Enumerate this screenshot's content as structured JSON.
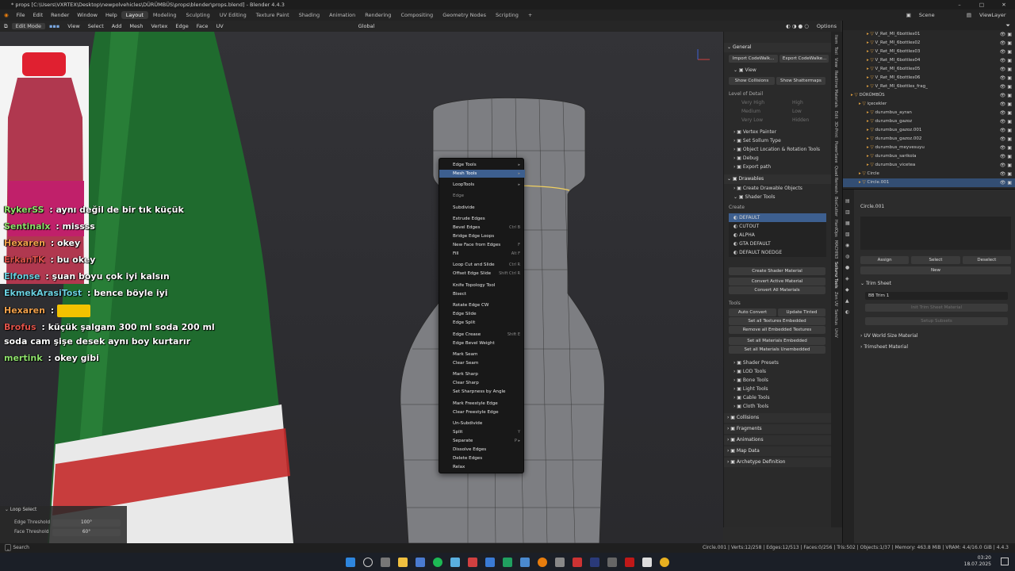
{
  "app": {
    "title": "* props [C:\\Users\\VXRTEX\\Desktop\\newpolvehicles\\DÜRÜMBÜS\\props\\blender\\props.blend] - Blender 4.4.3"
  },
  "menubar": {
    "menus": [
      "File",
      "Edit",
      "Render",
      "Window",
      "Help"
    ],
    "workspaces": [
      "Layout",
      "Modeling",
      "Sculpting",
      "UV Editing",
      "Texture Paint",
      "Shading",
      "Animation",
      "Rendering",
      "Compositing",
      "Geometry Nodes",
      "Scripting"
    ],
    "active_workspace": "Layout",
    "scene_label": "Scene",
    "viewlayer_label": "ViewLayer"
  },
  "viewport_header": {
    "mode": "Edit Mode",
    "items": [
      "View",
      "Select",
      "Add",
      "Mesh",
      "Vertex",
      "Edge",
      "Face",
      "UV"
    ],
    "transform_orientation": "Global",
    "options_label": "Options"
  },
  "chat": [
    {
      "user": "RykerSS",
      "sep": " : ",
      "text": "aynı değil de bir tık küçük",
      "color": "#8ee06b"
    },
    {
      "user": "Sentinalx",
      "sep": " : ",
      "text": "missss",
      "color": "#8ee06b"
    },
    {
      "user": "Hexaren",
      "sep": " : ",
      "text": "okey",
      "color": "#f0a04b"
    },
    {
      "user": "ErkanTK",
      "sep": " : ",
      "text": "bu okey",
      "color": "#e0534a"
    },
    {
      "user": "Elfonse",
      "sep": " : ",
      "text": "şuan boyu çok iyi kalsın",
      "color": "#6ad0e0"
    },
    {
      "user": "EkmekArasiTost",
      "sep": " : ",
      "text": "bence böyle iyi",
      "color": "#6ad0e0"
    },
    {
      "user": "Hexaren",
      "sep": " : ",
      "text": "",
      "color": "#f0a04b"
    },
    {
      "user": "Brofus",
      "sep": " : ",
      "text": "küçük şalgam 300 ml soda 200 ml",
      "color": "#e0534a"
    },
    {
      "user": "",
      "sep": "",
      "text": "soda cam şişe desek aynı boy kurtarır",
      "color": "#ffffff"
    },
    {
      "user": "mertink",
      "sep": " : ",
      "text": "okey gibi",
      "color": "#8ee06b"
    }
  ],
  "context_menu": {
    "items": [
      {
        "label": "Edge Tools",
        "shortcut": "▸",
        "type": "sub"
      },
      {
        "label": "Mesh Tools",
        "shortcut": "▸",
        "type": "sub",
        "highlight": true
      },
      {
        "label": "LoopTools",
        "shortcut": "▸",
        "type": "sub"
      },
      {
        "label": "Edge",
        "shortcut": "",
        "type": "title"
      },
      {
        "label": "Subdivide",
        "shortcut": "",
        "type": "item"
      },
      {
        "label": "Extrude Edges",
        "shortcut": "",
        "type": "item"
      },
      {
        "label": "Bevel Edges",
        "shortcut": "Ctrl B",
        "type": "item"
      },
      {
        "label": "Bridge Edge Loops",
        "shortcut": "",
        "type": "item"
      },
      {
        "label": "New Face from Edges",
        "shortcut": "F",
        "type": "item"
      },
      {
        "label": "Fill",
        "shortcut": "Alt F",
        "type": "item"
      },
      {
        "label": "Loop Cut and Slide",
        "shortcut": "Ctrl R",
        "type": "item"
      },
      {
        "label": "Offset Edge Slide",
        "shortcut": "Shift Ctrl R",
        "type": "item"
      },
      {
        "label": "Knife Topology Tool",
        "shortcut": "",
        "type": "item"
      },
      {
        "label": "Bisect",
        "shortcut": "",
        "type": "item"
      },
      {
        "label": "Rotate Edge CW",
        "shortcut": "",
        "type": "item"
      },
      {
        "label": "Edge Slide",
        "shortcut": "",
        "type": "item"
      },
      {
        "label": "Edge Split",
        "shortcut": "",
        "type": "item"
      },
      {
        "label": "Edge Crease",
        "shortcut": "Shift E",
        "type": "item"
      },
      {
        "label": "Edge Bevel Weight",
        "shortcut": "",
        "type": "item"
      },
      {
        "label": "Mark Seam",
        "shortcut": "",
        "type": "item"
      },
      {
        "label": "Clear Seam",
        "shortcut": "",
        "type": "item"
      },
      {
        "label": "Mark Sharp",
        "shortcut": "",
        "type": "item"
      },
      {
        "label": "Clear Sharp",
        "shortcut": "",
        "type": "item"
      },
      {
        "label": "Set Sharpness by Angle",
        "shortcut": "",
        "type": "item"
      },
      {
        "label": "Mark Freestyle Edge",
        "shortcut": "",
        "type": "item"
      },
      {
        "label": "Clear Freestyle Edge",
        "shortcut": "",
        "type": "item"
      },
      {
        "label": "Un-Subdivide",
        "shortcut": "",
        "type": "item"
      },
      {
        "label": "Split",
        "shortcut": "Y",
        "type": "item"
      },
      {
        "label": "Separate",
        "shortcut": "P ▸",
        "type": "item"
      },
      {
        "label": "Dissolve Edges",
        "shortcut": "",
        "type": "item"
      },
      {
        "label": "Delete Edges",
        "shortcut": "",
        "type": "item"
      },
      {
        "label": "Relax",
        "shortcut": "",
        "type": "item"
      }
    ]
  },
  "loop_select": {
    "title": "Loop Select",
    "edge_threshold_label": "Edge Threshold",
    "edge_threshold_value": "100°",
    "face_threshold_label": "Face Threshold",
    "face_threshold_value": "60°"
  },
  "npanel": {
    "general": "General",
    "import_btn": "Import CodeWalk...",
    "export_btn": "Export CodeWalke...",
    "view": "View",
    "show_collisions": "Show Collisions",
    "show_shattermaps": "Show Shattermaps",
    "lod_label": "Level of Detail",
    "lod_rows": [
      [
        "Very High",
        "High"
      ],
      [
        "Medium",
        "Low"
      ],
      [
        "Very Low",
        "Hidden"
      ]
    ],
    "sub1": [
      "Vertex Painter",
      "Set Sollum Type",
      "Object Location & Rotation Tools",
      "Debug",
      "Export path"
    ],
    "drawables": "Drawables",
    "create_drawable": "Create Drawable Objects",
    "shader_tools": "Shader Tools",
    "create": "Create",
    "shaders": [
      "DEFAULT",
      "CUTOUT",
      "ALPHA",
      "GTA DEFAULT",
      "DEFAULT NOEDGE"
    ],
    "create_shader_mat": "Create Shader Material",
    "convert_active": "Convert Active Material",
    "convert_all": "Convert All Materials",
    "tools": "Tools",
    "auto_convert": "Auto Convert",
    "update_tinted": "Update Tinted",
    "set_tex_emb": "Set all Textures Embedded",
    "remove_tex_emb": "Remove all Embedded Textures",
    "set_mat_emb": "Set all Materials Embedded",
    "set_mat_unemb": "Set all Materials Unembedded",
    "sub2": [
      "Shader Presets",
      "LOD Tools",
      "Bone Tools",
      "Light Tools",
      "Cable Tools",
      "Cloth Tools"
    ],
    "sub3": [
      "Collisions",
      "Fragments",
      "Animations",
      "Map Data",
      "Archetype Definition"
    ]
  },
  "npanel_tabs": [
    "Item",
    "Tool",
    "View",
    "Realtime Materials",
    "Edit",
    "3D-Print",
    "PowerSave",
    "Quad Remesh",
    "BoxCutter",
    "HardOps",
    "MACHIN3",
    "Sollumz Tools",
    "Zen UV",
    "Sanctus",
    "UniV"
  ],
  "outliner": {
    "rows": [
      {
        "label": "V_Ret_Ml_6bottles01",
        "indent": 3,
        "sel": false
      },
      {
        "label": "V_Ret_Ml_6bottles02",
        "indent": 3,
        "sel": false
      },
      {
        "label": "V_Ret_Ml_6bottles03",
        "indent": 3,
        "sel": false
      },
      {
        "label": "V_Ret_Ml_6bottles04",
        "indent": 3,
        "sel": false
      },
      {
        "label": "V_Ret_Ml_6bottles05",
        "indent": 3,
        "sel": false
      },
      {
        "label": "V_Ret_Ml_6bottles06",
        "indent": 3,
        "sel": false
      },
      {
        "label": "V_Ret_Ml_6bottles_frag_",
        "indent": 3,
        "sel": false
      },
      {
        "label": "DÜRÜMBÜS",
        "indent": 1,
        "sel": false
      },
      {
        "label": "içecekler",
        "indent": 2,
        "sel": false
      },
      {
        "label": "durumbus_ayran",
        "indent": 3,
        "sel": false
      },
      {
        "label": "durumbus_gazoz",
        "indent": 3,
        "sel": false
      },
      {
        "label": "durumbus_gazoz.001",
        "indent": 3,
        "sel": false
      },
      {
        "label": "durumbus_gazoz.002",
        "indent": 3,
        "sel": false
      },
      {
        "label": "durumbus_meyvesuyu",
        "indent": 3,
        "sel": false
      },
      {
        "label": "durumbus_sarikola",
        "indent": 3,
        "sel": false
      },
      {
        "label": "durumbus_vicetea",
        "indent": 3,
        "sel": false
      },
      {
        "label": "Circle",
        "indent": 2,
        "sel": false
      },
      {
        "label": "Circle.001",
        "indent": 2,
        "sel": true
      }
    ]
  },
  "props": {
    "object_name": "Circle.001",
    "assign": "Assign",
    "select": "Select",
    "deselect": "Deselect",
    "new": "New",
    "trim_sheet": "Trim Sheet",
    "trim_value": "BB Trim 1",
    "init_trim": "Init Trim Sheet Material",
    "setup_subsets": "Setup Subsets",
    "uv_world": "UV World Size Material",
    "trimsheet_mat": "Trimsheet Material"
  },
  "statusbar": {
    "left": "Search",
    "stats": "Circle.001 | Verts:12/258 | Edges:12/513 | Faces:0/256 | Tris:502 | Objects:1/37 | Memory: 463.8 MiB | VRAM: 4.4/16.0 GiB | 4.4.3"
  },
  "taskbar": {
    "time": "03:20",
    "date": "18.07.2025"
  },
  "colors": {
    "accent": "#3d5f8f",
    "selected_row": "#334e73",
    "bottle_green": "#1f6b2e"
  }
}
